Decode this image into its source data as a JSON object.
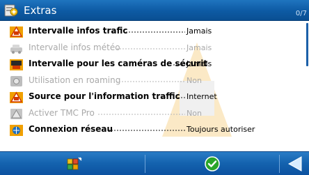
{
  "header": {
    "title": "Extras",
    "page_count": "0/7"
  },
  "settings": [
    {
      "label": "Intervalle infos trafic",
      "value": "Jamais",
      "enabled": true,
      "icon": "traffic-warning-icon"
    },
    {
      "label": "Intervalle infos météo",
      "value": "Jamais",
      "enabled": false,
      "icon": "weather-car-icon"
    },
    {
      "label": "Intervalle pour les caméras de sécurit",
      "value": "Jamais",
      "enabled": true,
      "icon": "speed-camera-icon"
    },
    {
      "label": "Utilisation en roaming",
      "value": "Non",
      "enabled": false,
      "icon": "roaming-icon"
    },
    {
      "label": "Source pour l'information traffic",
      "value": "Internet",
      "enabled": true,
      "icon": "traffic-source-icon"
    },
    {
      "label": "Activer TMC Pro",
      "value": "Non",
      "enabled": false,
      "icon": "tmc-pro-icon"
    },
    {
      "label": "Connexion réseau",
      "value": "Toujours autoriser",
      "enabled": true,
      "icon": "network-connection-icon"
    }
  ],
  "toolbar": {
    "menu_icon": "menu-icon",
    "ok_icon": "checkmark-icon",
    "back_icon": "back-arrow-icon"
  },
  "colors": {
    "bar_blue": "#0d5aa3",
    "disabled_text": "#a9a9a9",
    "ok_green": "#2aa52a"
  }
}
